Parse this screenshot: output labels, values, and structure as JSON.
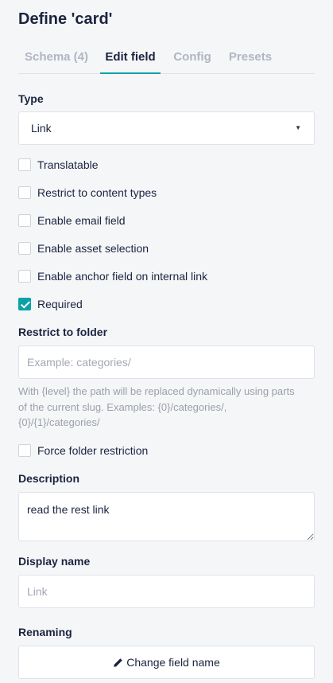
{
  "header": {
    "title": "Define 'card'"
  },
  "tabs": [
    {
      "label": "Schema (4)",
      "active": false
    },
    {
      "label": "Edit field",
      "active": true
    },
    {
      "label": "Config",
      "active": false
    },
    {
      "label": "Presets",
      "active": false
    }
  ],
  "type": {
    "label": "Type",
    "selected": "Link",
    "caret_icon": "caret-down-icon"
  },
  "options": [
    {
      "label": "Translatable",
      "checked": false
    },
    {
      "label": "Restrict to content types",
      "checked": false
    },
    {
      "label": "Enable email field",
      "checked": false
    },
    {
      "label": "Enable asset selection",
      "checked": false
    },
    {
      "label": "Enable anchor field on internal link",
      "checked": false
    },
    {
      "label": "Required",
      "checked": true
    }
  ],
  "folder": {
    "label": "Restrict to folder",
    "placeholder": "Example: categories/",
    "value": "",
    "help": "With {level} the path will be replaced dynamically using parts of the current slug. Examples: {0}/categories/, {0}/{1}/categories/"
  },
  "force_folder": {
    "label": "Force folder restriction",
    "checked": false
  },
  "description": {
    "label": "Description",
    "value": "read the rest link"
  },
  "display_name": {
    "label": "Display name",
    "placeholder": "Link",
    "value": ""
  },
  "renaming": {
    "label": "Renaming",
    "button_label": "Change field name",
    "button_icon": "pencil-icon"
  },
  "colors": {
    "accent": "#09a2a7",
    "text": "#1b243f",
    "muted": "#b1b6c3",
    "background": "#f5f6f8"
  }
}
